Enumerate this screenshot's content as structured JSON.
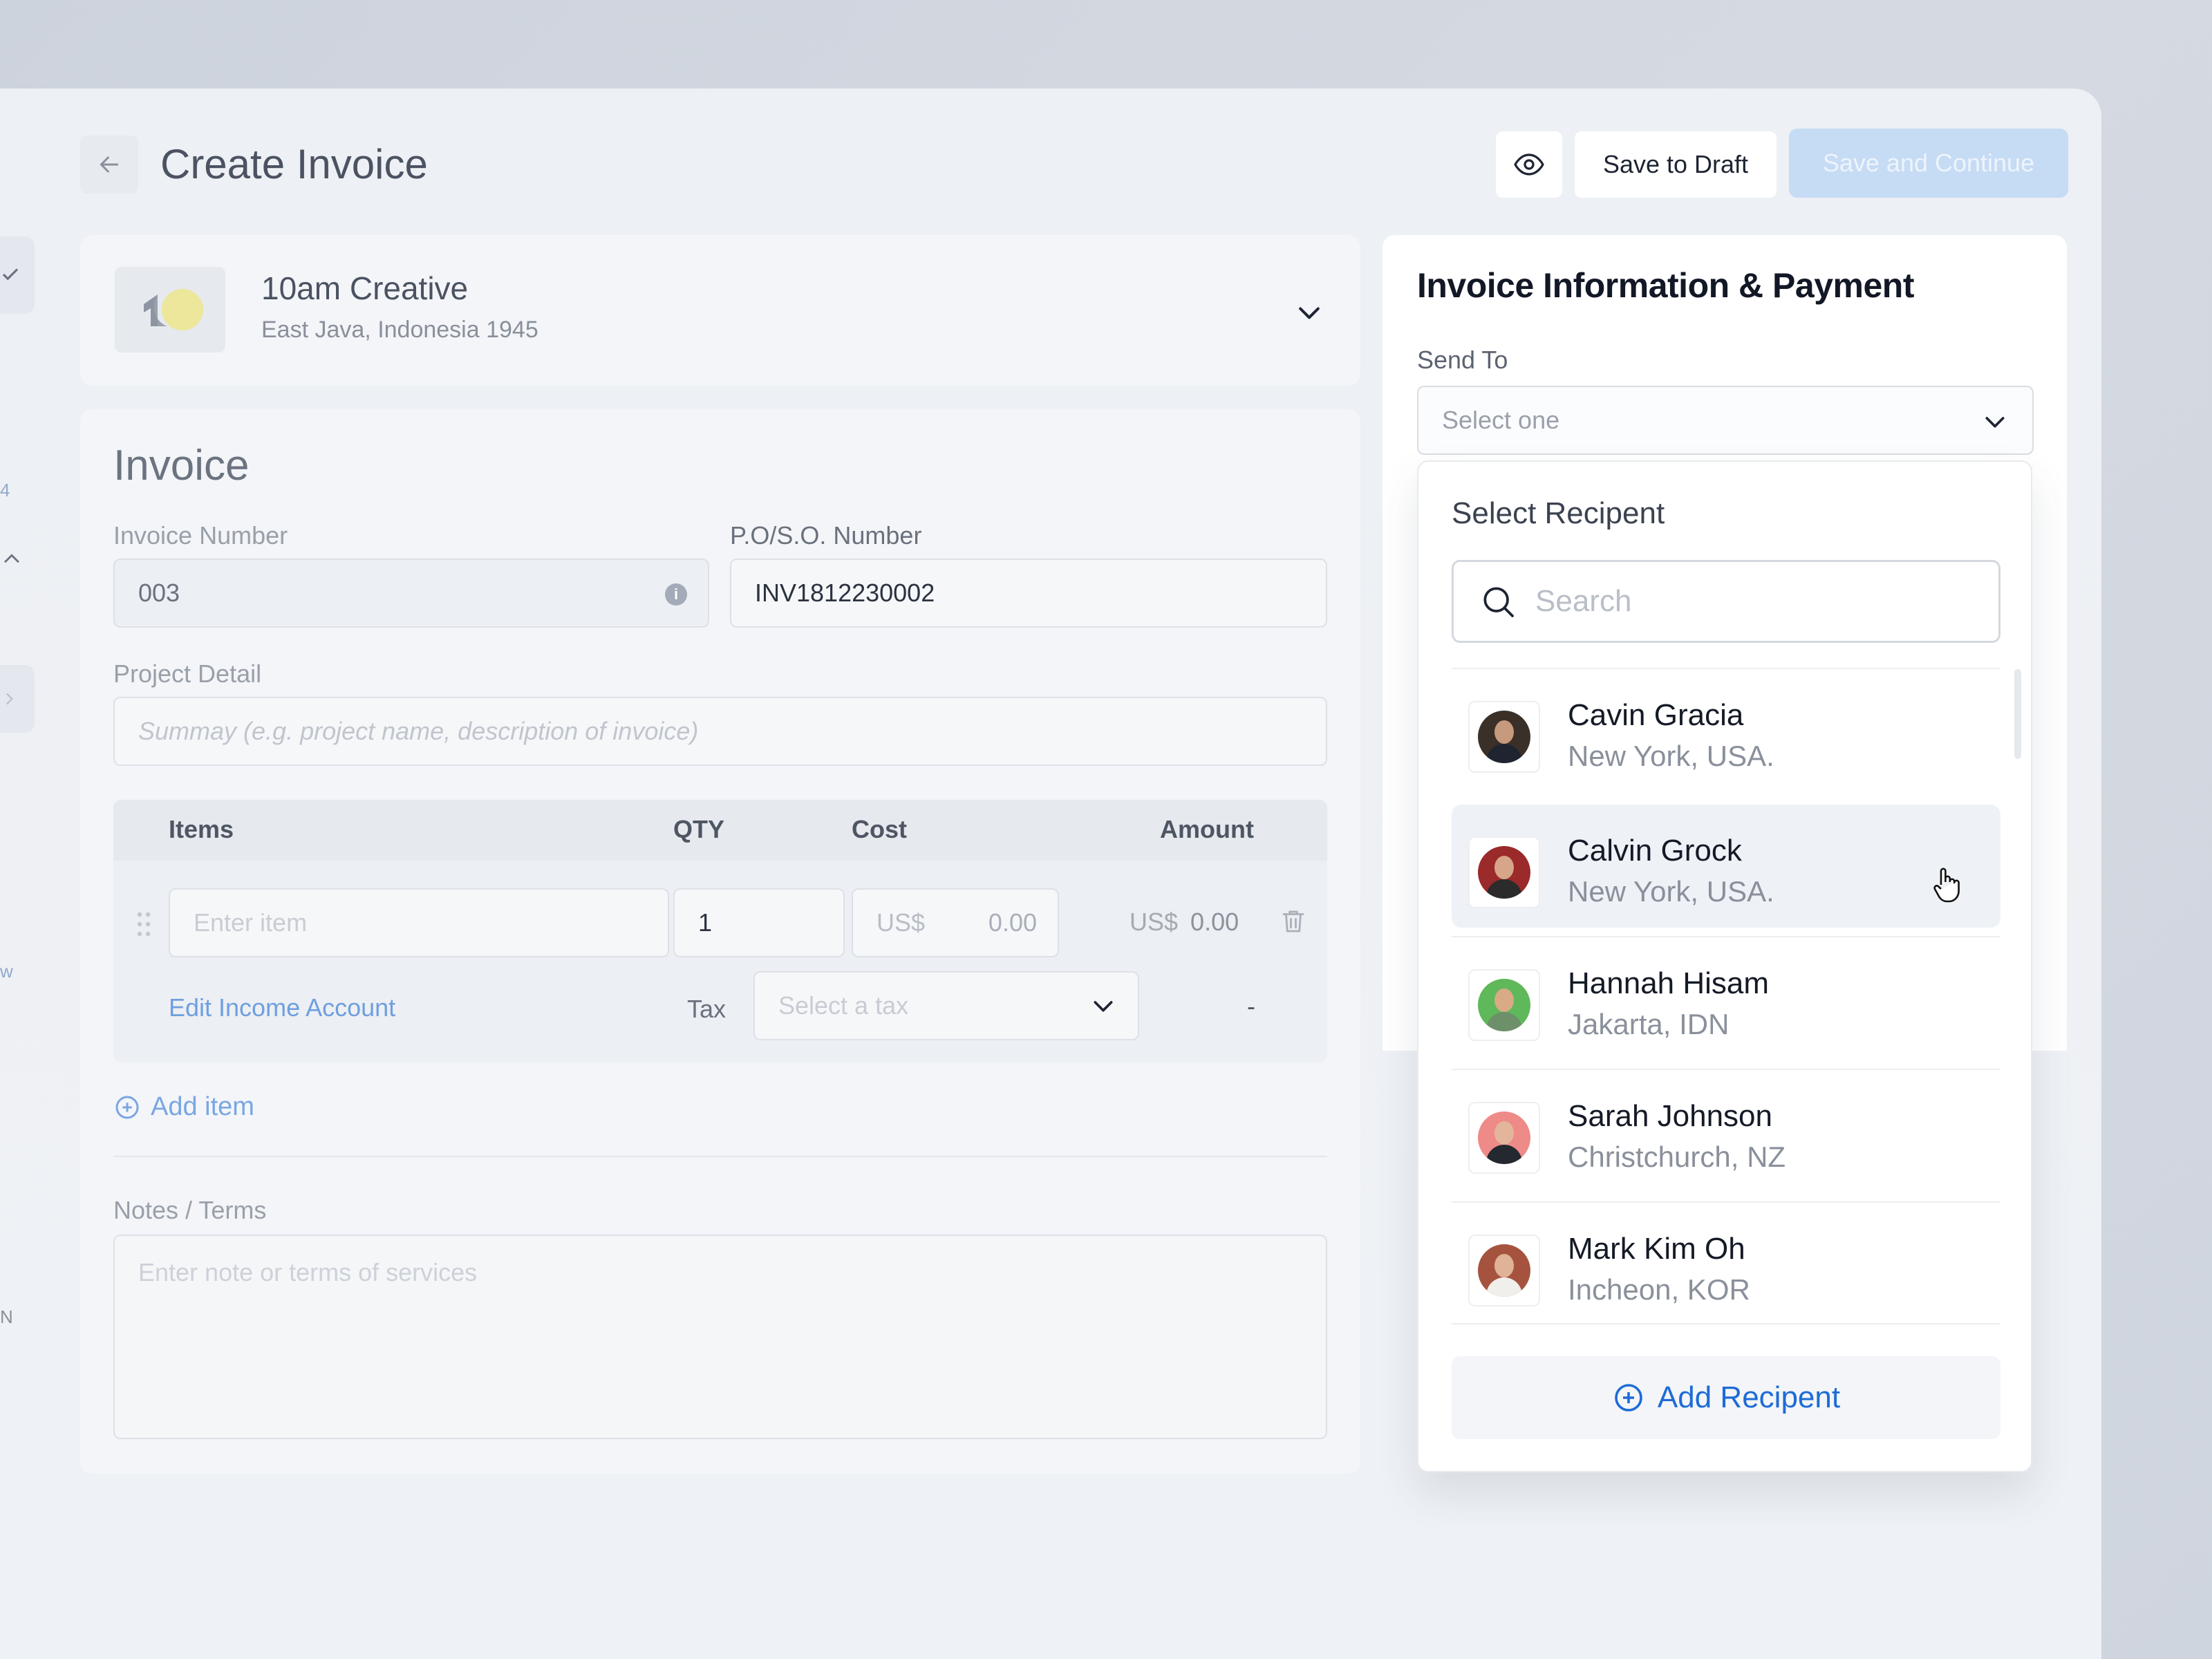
{
  "header": {
    "title": "Create Invoice",
    "save_draft_label": "Save to Draft",
    "save_continue_label": "Save and Continue"
  },
  "rail": {
    "badge_1": "4",
    "badge_2": "w",
    "badge_3": "N"
  },
  "company": {
    "name": "10am Creative",
    "address": "East Java, Indonesia 1945"
  },
  "invoice": {
    "section_title": "Invoice",
    "number_label": "Invoice Number",
    "number_value": "003",
    "po_label": "P.O/S.O. Number",
    "po_value": "INV1812230002",
    "project_label": "Project Detail",
    "project_placeholder": "Summay (e.g. project name, description of invoice)",
    "columns": {
      "items": "Items",
      "qty": "QTY",
      "cost": "Cost",
      "amount": "Amount"
    },
    "row": {
      "item_placeholder": "Enter item",
      "qty": "1",
      "cost_currency": "US$",
      "cost_value": "0.00",
      "amount_currency": "US$",
      "amount_value": "0.00",
      "edit_income_label": "Edit Income Account",
      "tax_label": "Tax",
      "tax_placeholder": "Select a tax",
      "tax_amount": "-"
    },
    "add_item_label": "Add item",
    "notes_label": "Notes / Terms",
    "notes_placeholder": "Enter note or terms of services"
  },
  "payment": {
    "title": "Invoice Information & Payment",
    "send_to_label": "Send To",
    "send_to_placeholder": "Select one"
  },
  "recipient_dropdown": {
    "title": "Select Recipent",
    "search_placeholder": "Search",
    "recipients": [
      {
        "name": "Cavin Gracia",
        "location": "New York, USA."
      },
      {
        "name": "Calvin Grock",
        "location": "New York, USA."
      },
      {
        "name": "Hannah Hisam",
        "location": "Jakarta, IDN"
      },
      {
        "name": "Sarah Johnson",
        "location": "Christchurch, NZ"
      },
      {
        "name": "Mark Kim Oh",
        "location": "Incheon, KOR"
      }
    ],
    "add_label": "Add Recipent"
  },
  "icons": [
    "arrow-left-icon",
    "eye-icon",
    "chevron-down-icon",
    "info-icon",
    "drag-handle-icon",
    "trash-icon",
    "plus-circle-icon",
    "search-icon",
    "hand-pointer-icon",
    "check-icon",
    "chevron-up-icon",
    "chevron-right-icon"
  ],
  "colors": {
    "accent": "#1e6bd6",
    "primary_disabled": "#c6dbf4",
    "link": "#6e9fe0"
  }
}
